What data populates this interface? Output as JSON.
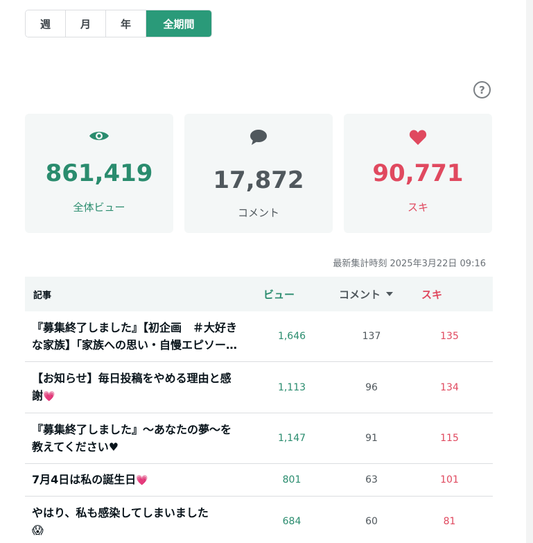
{
  "period_tabs": {
    "week": "週",
    "month": "月",
    "year": "年",
    "all": "全期間",
    "active": "all"
  },
  "help_icon": "?",
  "stats": {
    "views": {
      "value": "861,419",
      "label": "全体ビュー",
      "icon": "eye-icon",
      "color": "#2a8c6e"
    },
    "comments": {
      "value": "17,872",
      "label": "コメント",
      "icon": "comment-bubble-icon",
      "color": "#50585d"
    },
    "likes": {
      "value": "90,771",
      "label": "スキ",
      "icon": "heart-icon",
      "color": "#e0495f"
    }
  },
  "last_updated": "最新集計時刻 2025年3月22日 09:16",
  "table": {
    "headers": {
      "title": "記事",
      "views": "ビュー",
      "comments": "コメント",
      "likes": "スキ"
    },
    "sort_column": "comments",
    "rows": [
      {
        "title": "『募集終了しました』【初企画　＃大好きな家族】「家族への思い・自慢エピソード」",
        "views": "1,646",
        "comments": "137",
        "likes": "135"
      },
      {
        "title": "【お知らせ】毎日投稿をやめる理由と感謝",
        "emoji": "💗",
        "views": "1,113",
        "comments": "96",
        "likes": "134"
      },
      {
        "title": "『募集終了しました』〜あなたの夢〜を教えてください♥",
        "views": "1,147",
        "comments": "91",
        "likes": "115"
      },
      {
        "title": "7月4日は私の誕生日",
        "emoji": "💗",
        "views": "801",
        "comments": "63",
        "likes": "101"
      },
      {
        "title": "やはり、私も感染してしまいました",
        "emoji": "😱",
        "views": "684",
        "comments": "60",
        "likes": "81"
      }
    ]
  }
}
